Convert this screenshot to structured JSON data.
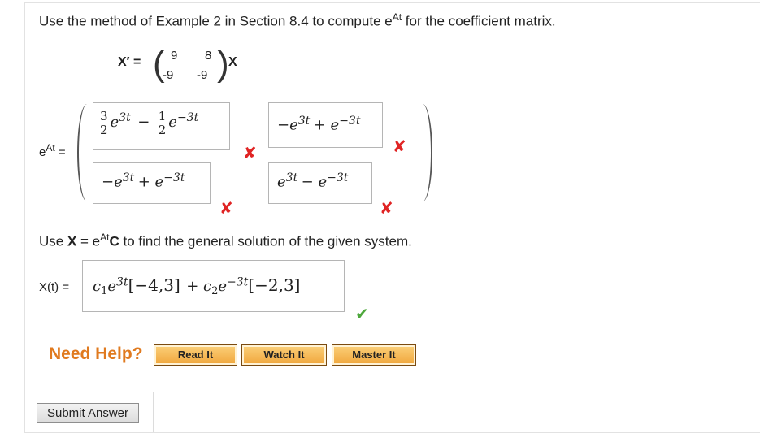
{
  "prompt": {
    "text_pre": "Use the method of Example 2 in Section 8.4 to compute e",
    "sup": "At",
    "text_post": " for the coefficient matrix."
  },
  "system": {
    "lhs": "X′ =",
    "matrix": [
      [
        "9",
        "8"
      ],
      [
        "-9",
        "-9"
      ]
    ],
    "rhs": "X"
  },
  "eAt_label": {
    "base": "e",
    "sup": "At",
    "eq": "="
  },
  "entries": {
    "a11": {
      "frac1_num": "3",
      "frac1_den": "2",
      "exp1": "3t",
      "minus": "−",
      "frac2_num": "1",
      "frac2_den": "2",
      "exp2": "−3t"
    },
    "a12": {
      "lead": "−e",
      "exp1": "3t",
      "plus": "+ e",
      "exp2": "−3t"
    },
    "a21": {
      "lead": "−e",
      "exp1": "3t",
      "plus": "+ e",
      "exp2": "−3t"
    },
    "a22": {
      "lead": "e",
      "exp1": "3t",
      "minus": "− e",
      "exp2": "−3t"
    }
  },
  "marks": {
    "wrong": "✘",
    "right": "✔"
  },
  "general": {
    "pre": "Use ",
    "x": "X",
    "eq": " = e",
    "sup": "At",
    "c": "C",
    "post": " to find the general solution of the given system."
  },
  "solution": {
    "label": "X(t) =",
    "c1": "c",
    "sub1": "1",
    "e1": "e",
    "exp1": "3t",
    "vec1": "[−4,3]",
    "plus": "+ c",
    "sub2": "2",
    "e2": "e",
    "exp2": "−3t",
    "vec2": "[−2,3]"
  },
  "help": {
    "label": "Need Help?",
    "buttons": [
      "Read It",
      "Watch It",
      "Master It"
    ]
  },
  "submit_label": "Submit Answer"
}
